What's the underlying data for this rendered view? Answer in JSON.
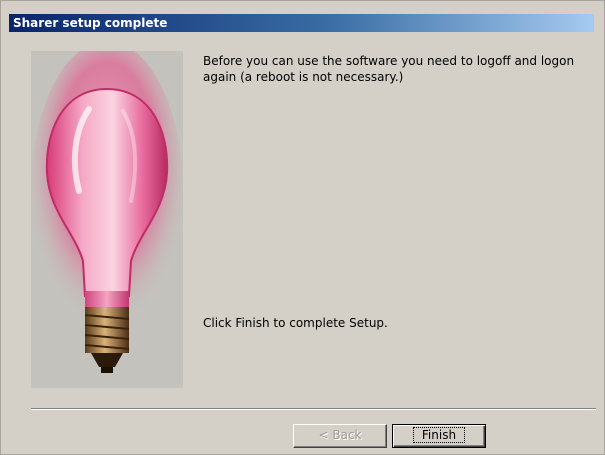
{
  "window": {
    "title": "Sharer setup complete"
  },
  "content": {
    "message": "Before you can use the software you need to logoff and logon again (a reboot is not necessary.)",
    "finish_instruction": "Click Finish to complete Setup.",
    "image": "lightbulb-illustration"
  },
  "buttons": {
    "back_label": "< Back",
    "back_enabled": false,
    "finish_label": "Finish",
    "finish_is_default": true
  },
  "colors": {
    "dialog_background": "#d4d0c8",
    "title_gradient_start": "#0a246a",
    "title_gradient_end": "#a6caf0",
    "bulb_glow": "#e8508a"
  }
}
